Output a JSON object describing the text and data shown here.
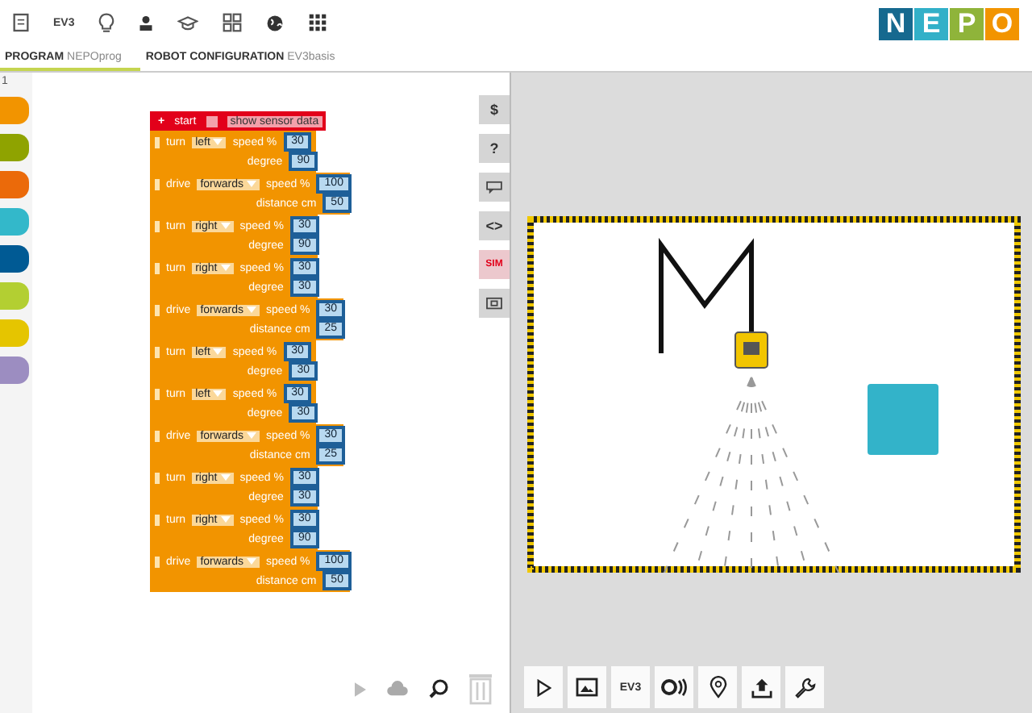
{
  "toolbar": {
    "robot_label": "EV3"
  },
  "logo": {
    "letters": [
      {
        "char": "N",
        "color": "#16698f"
      },
      {
        "char": "E",
        "color": "#32b0c8"
      },
      {
        "char": "P",
        "color": "#8fb43a"
      },
      {
        "char": "O",
        "color": "#f29400"
      }
    ]
  },
  "tabs": [
    {
      "title": "PROGRAM",
      "subtitle": "NEPOprog",
      "selected": true
    },
    {
      "title": "ROBOT CONFIGURATION",
      "subtitle": "EV3basis",
      "selected": false
    }
  ],
  "palette": {
    "counter": "1",
    "categories": [
      {
        "color": "#f29400"
      },
      {
        "color": "#8fa300"
      },
      {
        "color": "#eb6a0a"
      },
      {
        "color": "#33b8ca"
      },
      {
        "color": "#005a94"
      },
      {
        "color": "#b3cf32"
      },
      {
        "color": "#e5c500"
      },
      {
        "color": "#9c8dc1"
      }
    ]
  },
  "program": {
    "start": {
      "add_symbol": "+",
      "label": "start",
      "checkbox_label": "show sensor data",
      "checked": false
    },
    "blocks": [
      {
        "label": "turn",
        "direction": "left",
        "speed_label": "speed %",
        "speed": "30",
        "second_label": "degree",
        "second_value": "90"
      },
      {
        "label": "drive",
        "direction": "forwards",
        "speed_label": "speed %",
        "speed": "100",
        "second_label": "distance cm",
        "second_value": "50"
      },
      {
        "label": "turn",
        "direction": "right",
        "speed_label": "speed %",
        "speed": "30",
        "second_label": "degree",
        "second_value": "90"
      },
      {
        "label": "turn",
        "direction": "right",
        "speed_label": "speed %",
        "speed": "30",
        "second_label": "degree",
        "second_value": "30"
      },
      {
        "label": "drive",
        "direction": "forwards",
        "speed_label": "speed %",
        "speed": "30",
        "second_label": "distance cm",
        "second_value": "25"
      },
      {
        "label": "turn",
        "direction": "left",
        "speed_label": "speed %",
        "speed": "30",
        "second_label": "degree",
        "second_value": "30"
      },
      {
        "label": "turn",
        "direction": "left",
        "speed_label": "speed %",
        "speed": "30",
        "second_label": "degree",
        "second_value": "30"
      },
      {
        "label": "drive",
        "direction": "forwards",
        "speed_label": "speed %",
        "speed": "30",
        "second_label": "distance cm",
        "second_value": "25"
      },
      {
        "label": "turn",
        "direction": "right",
        "speed_label": "speed %",
        "speed": "30",
        "second_label": "degree",
        "second_value": "30"
      },
      {
        "label": "turn",
        "direction": "right",
        "speed_label": "speed %",
        "speed": "30",
        "second_label": "degree",
        "second_value": "90"
      },
      {
        "label": "drive",
        "direction": "forwards",
        "speed_label": "speed %",
        "speed": "100",
        "second_label": "distance cm",
        "second_value": "50"
      }
    ]
  },
  "side_tools": [
    {
      "kind": "text",
      "label": "$",
      "selected": false
    },
    {
      "kind": "text",
      "label": "?",
      "selected": false
    },
    {
      "kind": "comment",
      "selected": false
    },
    {
      "kind": "text",
      "label": "<>",
      "selected": false
    },
    {
      "kind": "text",
      "label": "SIM",
      "selected": true
    },
    {
      "kind": "screen",
      "selected": false
    }
  ],
  "sim": {
    "obstacle": {
      "color": "#33b3c9"
    },
    "controls": [
      {
        "kind": "play"
      },
      {
        "kind": "image"
      },
      {
        "kind": "text",
        "label": "EV3"
      },
      {
        "kind": "sound"
      },
      {
        "kind": "pin"
      },
      {
        "kind": "upload"
      },
      {
        "kind": "wrench"
      }
    ]
  }
}
